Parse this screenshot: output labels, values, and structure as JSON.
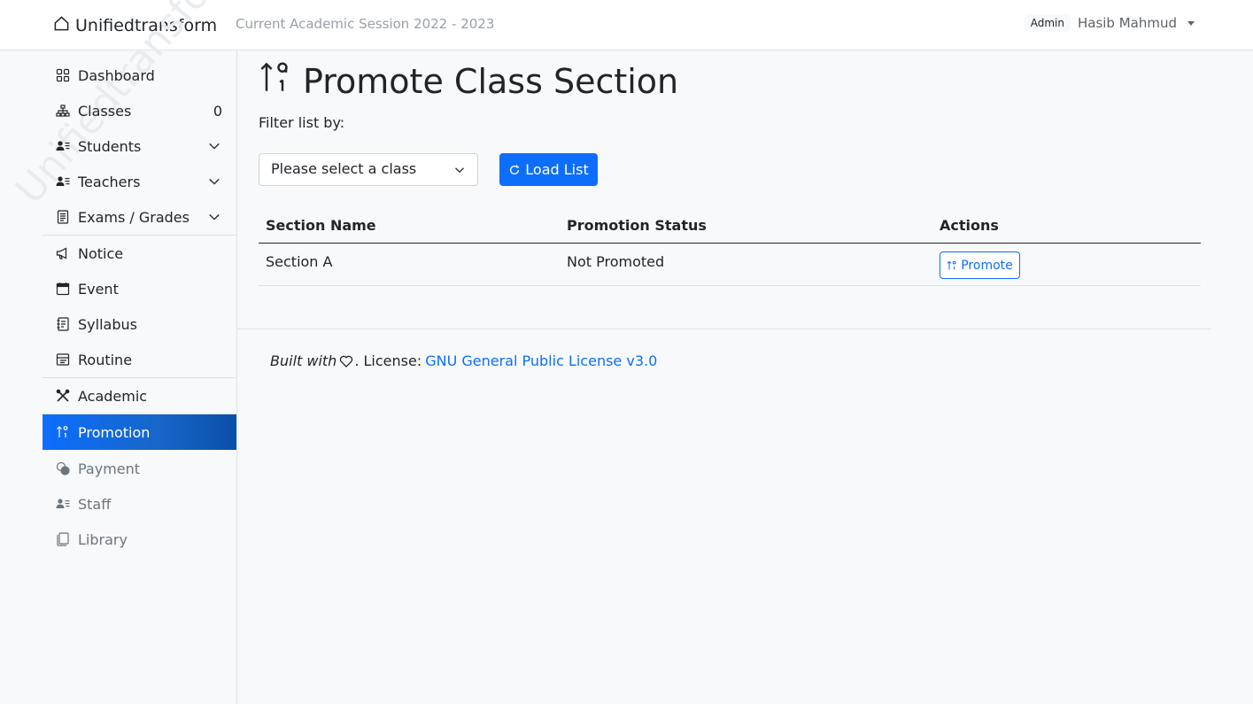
{
  "header": {
    "brand": "Unifiedtransform",
    "session": "Current Academic Session 2022 - 2023",
    "role": "Admin",
    "user_name": "Hasib Mahmud"
  },
  "sidebar": {
    "watermark": "Unifiedtransform",
    "items": [
      {
        "label": "Dashboard",
        "icon": "dashboard-icon"
      },
      {
        "label": "Classes",
        "icon": "diagram-icon",
        "count": "0"
      },
      {
        "label": "Students",
        "icon": "person-lines-icon"
      },
      {
        "label": "Teachers",
        "icon": "person-lines-icon"
      },
      {
        "label": "Exams / Grades",
        "icon": "file-text-icon"
      },
      {
        "label": "Notice",
        "icon": "megaphone-icon"
      },
      {
        "label": "Event",
        "icon": "calendar-icon"
      },
      {
        "label": "Syllabus",
        "icon": "journal-text-icon"
      },
      {
        "label": "Routine",
        "icon": "calendar-grid-icon"
      },
      {
        "label": "Academic",
        "icon": "tools-icon"
      },
      {
        "label": "Promotion",
        "icon": "sort-numeric-up-icon"
      },
      {
        "label": "Payment",
        "icon": "coins-icon"
      },
      {
        "label": "Staff",
        "icon": "person-lines-icon"
      },
      {
        "label": "Library",
        "icon": "journals-icon"
      }
    ]
  },
  "main": {
    "title": "Promote Class Section",
    "filter_label": "Filter list by:",
    "select_placeholder": "Please select a class",
    "load_button": "Load List",
    "table": {
      "headers": [
        "Section Name",
        "Promotion Status",
        "Actions"
      ],
      "rows": [
        {
          "section": "Section A",
          "status": "Not Promoted",
          "action": "Promote"
        }
      ]
    }
  },
  "footer": {
    "built_with": "Built with",
    "license_prefix": ". License:",
    "license_link": "GNU General Public License v3.0"
  },
  "colors": {
    "primary": "#0d6efd",
    "muted": "#6c757d",
    "border": "#dee2e6"
  }
}
